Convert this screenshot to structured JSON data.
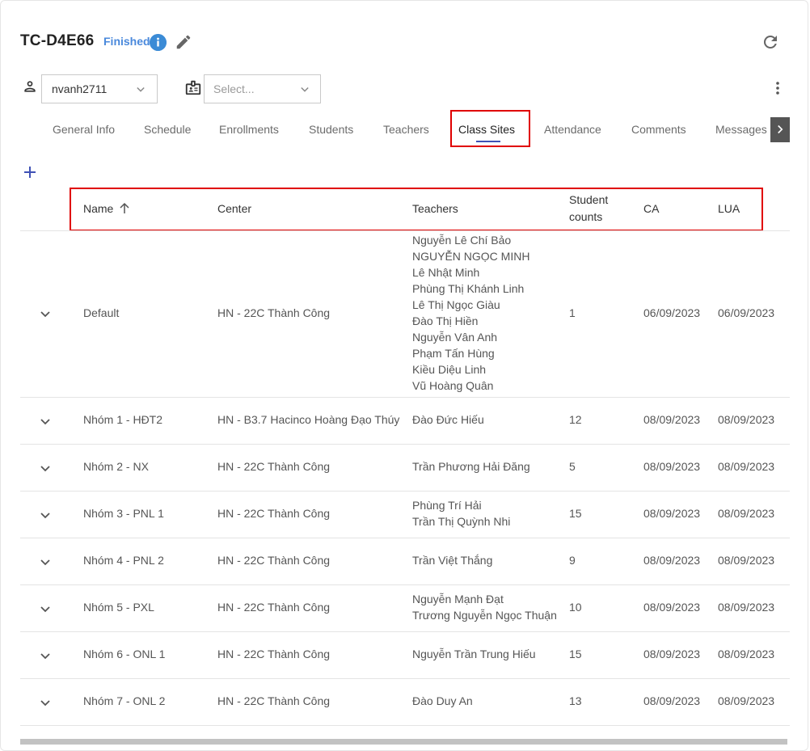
{
  "header": {
    "title": "TC-D4E66",
    "status": "Finished"
  },
  "filters": {
    "user_value": "nvanh2711",
    "second_placeholder": "Select..."
  },
  "tabs": [
    {
      "label": "General Info"
    },
    {
      "label": "Schedule"
    },
    {
      "label": "Enrollments"
    },
    {
      "label": "Students"
    },
    {
      "label": "Teachers"
    },
    {
      "label": "Class Sites"
    },
    {
      "label": "Attendance"
    },
    {
      "label": "Comments"
    },
    {
      "label": "Messages"
    }
  ],
  "active_tab": "Class Sites",
  "table": {
    "columns": [
      "Name",
      "Center",
      "Teachers",
      "Student counts",
      "CA",
      "LUA"
    ],
    "column_header_lines": {
      "student_counts_1": "Student",
      "student_counts_2": "counts"
    },
    "rows": [
      {
        "name": "Default",
        "center": "HN - 22C Thành Công",
        "teachers": [
          "Nguyễn Lê Chí Bảo",
          "NGUYỄN NGỌC MINH",
          "Lê Nhật Minh",
          "Phùng Thị Khánh Linh",
          "Lê Thị Ngọc Giàu",
          "Đào Thị Hiền",
          "Nguyễn Vân Anh",
          "Phạm Tấn Hùng",
          "Kiều Diệu Linh",
          "Vũ Hoàng Quân"
        ],
        "student_counts": "1",
        "ca": "06/09/2023",
        "lua": "06/09/2023"
      },
      {
        "name": "Nhóm 1 - HĐT2",
        "center": "HN - B3.7 Hacinco Hoàng Đạo Thúy",
        "teachers": [
          "Đào Đức Hiếu"
        ],
        "student_counts": "12",
        "ca": "08/09/2023",
        "lua": "08/09/2023"
      },
      {
        "name": "Nhóm 2 - NX",
        "center": "HN - 22C Thành Công",
        "teachers": [
          "Trần Phương Hải Đăng"
        ],
        "student_counts": "5",
        "ca": "08/09/2023",
        "lua": "08/09/2023"
      },
      {
        "name": "Nhóm 3 - PNL 1",
        "center": "HN - 22C Thành Công",
        "teachers": [
          "Phùng Trí Hải",
          "Trần Thị Quỳnh Nhi"
        ],
        "student_counts": "15",
        "ca": "08/09/2023",
        "lua": "08/09/2023"
      },
      {
        "name": "Nhóm 4 - PNL 2",
        "center": "HN - 22C Thành Công",
        "teachers": [
          "Trần Việt Thắng"
        ],
        "student_counts": "9",
        "ca": "08/09/2023",
        "lua": "08/09/2023"
      },
      {
        "name": "Nhóm 5 - PXL",
        "center": "HN - 22C Thành Công",
        "teachers": [
          "Nguyễn Mạnh Đạt",
          "Trương Nguyễn Ngọc Thuận"
        ],
        "student_counts": "10",
        "ca": "08/09/2023",
        "lua": "08/09/2023"
      },
      {
        "name": "Nhóm 6 - ONL 1",
        "center": "HN - 22C Thành Công",
        "teachers": [
          "Nguyễn Trần Trung Hiếu"
        ],
        "student_counts": "15",
        "ca": "08/09/2023",
        "lua": "08/09/2023"
      },
      {
        "name": "Nhóm 7 - ONL 2",
        "center": "HN - 22C Thành Công",
        "teachers": [
          "Đào Duy An"
        ],
        "student_counts": "13",
        "ca": "08/09/2023",
        "lua": "08/09/2023"
      }
    ]
  },
  "colors": {
    "status": "#4a89dc",
    "accent": "#3f51b5",
    "highlight": "#e00000"
  },
  "icons": [
    "info-icon",
    "edit-icon",
    "refresh-icon",
    "person-icon",
    "badge-icon",
    "more-vert-icon",
    "chevron-right-icon",
    "add-icon",
    "sort-arrow-up-icon",
    "expand-icon"
  ]
}
